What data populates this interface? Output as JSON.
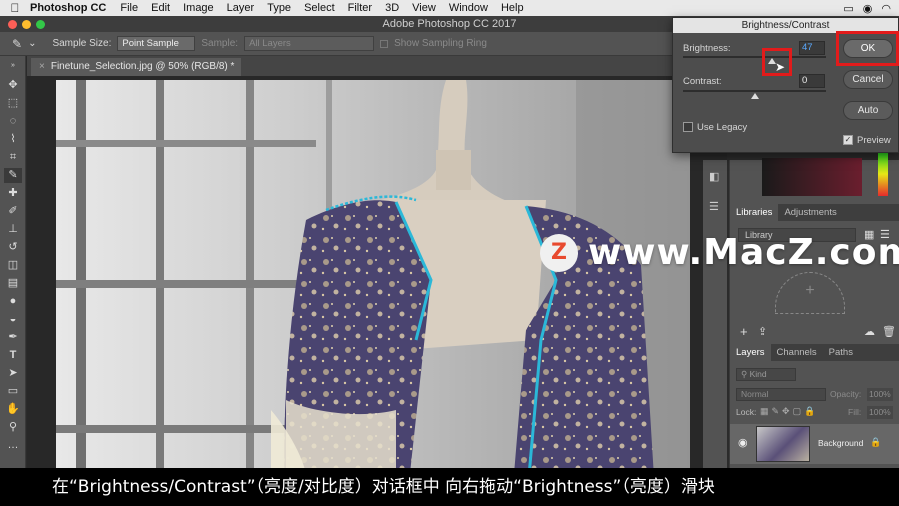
{
  "menubar": {
    "app_name": "Photoshop CC",
    "items": [
      "File",
      "Edit",
      "Image",
      "Layer",
      "Type",
      "Select",
      "Filter",
      "3D",
      "View",
      "Window",
      "Help"
    ]
  },
  "window": {
    "title": "Adobe Photoshop CC 2017"
  },
  "options": {
    "sample_size_label": "Sample Size:",
    "sample_size_value": "Point Sample",
    "sample_label": "Sample:",
    "sample_value": "All Layers",
    "show_ring": "Show Sampling Ring"
  },
  "document": {
    "tab_title": "Finetune_Selection.jpg @ 50% (RGB/8) *"
  },
  "dialog": {
    "title": "Brightness/Contrast",
    "brightness_label": "Brightness:",
    "brightness_value": "47",
    "brightness_level": 0.62,
    "contrast_label": "Contrast:",
    "contrast_value": "0",
    "contrast_level": 0.5,
    "legacy_label": "Use Legacy",
    "preview_label": "Preview",
    "ok_label": "OK",
    "cancel_label": "Cancel",
    "auto_label": "Auto"
  },
  "panels": {
    "libraries_tabs": [
      "Libraries",
      "Adjustments"
    ],
    "library_select": "Library",
    "layers_tabs": [
      "Layers",
      "Channels",
      "Paths"
    ],
    "kind_label": "Kind",
    "blend_mode": "Normal",
    "opacity_label": "Opacity:",
    "opacity_value": "100%",
    "lock_label": "Lock:",
    "fill_label": "Fill:",
    "fill_value": "100%",
    "layer_name": "Background"
  },
  "watermark": {
    "logo_letter": "Z",
    "text": "www.MacZ.com"
  },
  "subtitle": {
    "text": "在“Brightness/Contrast”（亮度/对比度）对话框中 向右拖动“Brightness”（亮度）滑块"
  },
  "colors": {
    "highlight_red": "#e21b1b",
    "selection_cyan": "#2bb8d8"
  }
}
